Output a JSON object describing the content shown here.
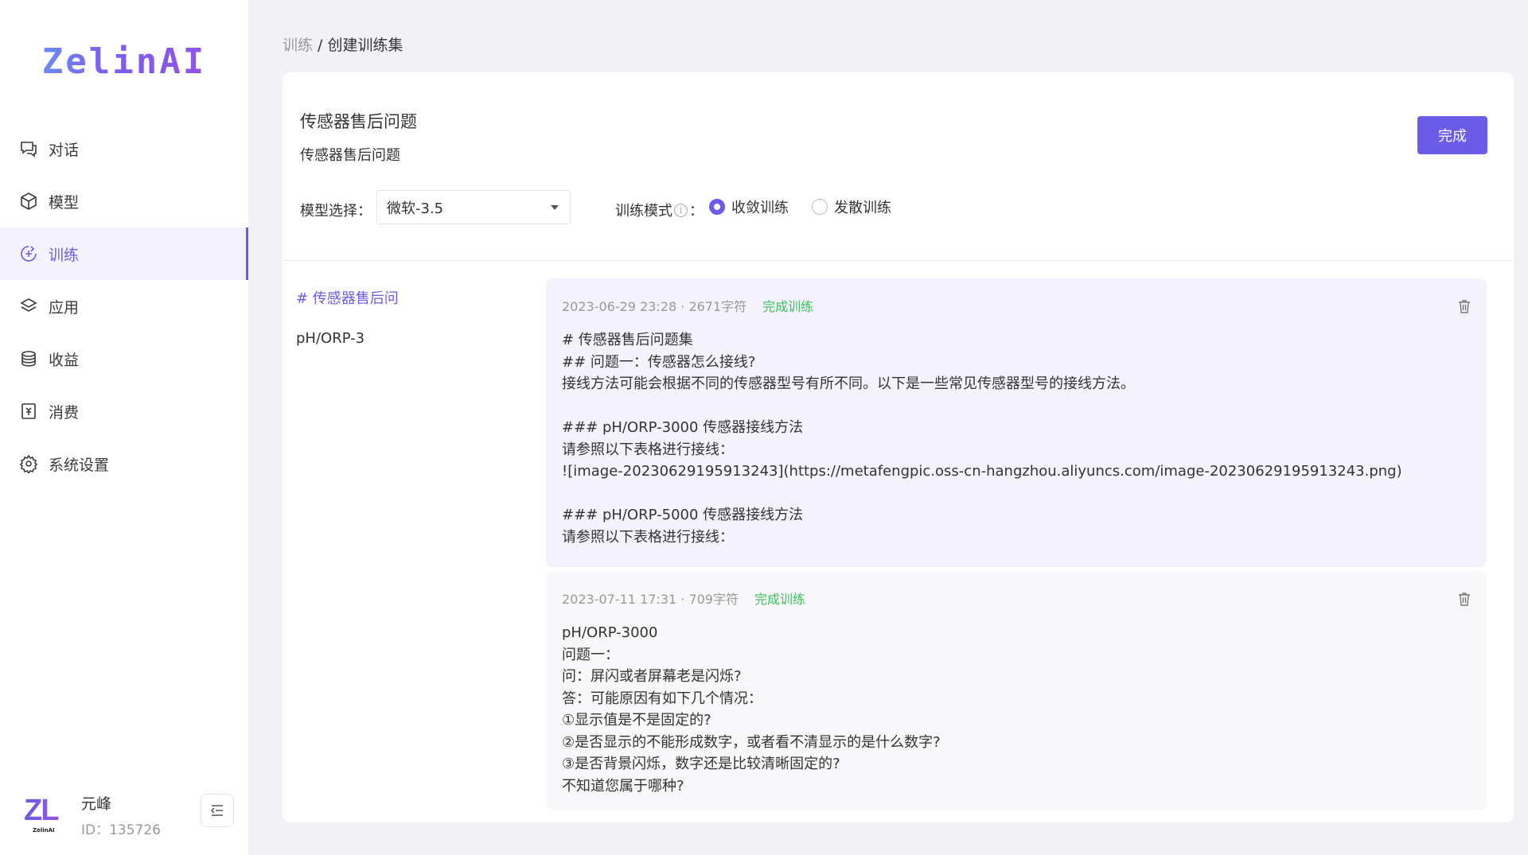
{
  "app": {
    "logo": "ZelinAI"
  },
  "sidebar": {
    "items": [
      {
        "label": "对话",
        "icon": "chat-icon"
      },
      {
        "label": "模型",
        "icon": "cube-icon"
      },
      {
        "label": "训练",
        "icon": "training-icon",
        "active": true
      },
      {
        "label": "应用",
        "icon": "layers-icon"
      },
      {
        "label": "收益",
        "icon": "coins-icon"
      },
      {
        "label": "消费",
        "icon": "receipt-icon"
      },
      {
        "label": "系统设置",
        "icon": "gear-icon"
      }
    ]
  },
  "user": {
    "avatar_text": "ZL",
    "avatar_small": "ZelinAI",
    "name": "元峰",
    "id": "ID：135726"
  },
  "breadcrumb": {
    "parent": "训练",
    "separator": " / ",
    "current": "创建训练集"
  },
  "training_set": {
    "title": "传感器售后问题",
    "description": "传感器售后问题",
    "done_label": "完成",
    "model_label": "模型选择：",
    "model_value": "微软-3.5",
    "mode_label": "训练模式",
    "mode_colon": "：",
    "modes": [
      {
        "label": "收敛训练",
        "selected": true
      },
      {
        "label": "发散训练",
        "selected": false
      }
    ]
  },
  "files": [
    {
      "label": "# 传感器售后问",
      "active": true
    },
    {
      "label": "pH/ORP-3",
      "active": false
    }
  ],
  "chunks": [
    {
      "meta": "2023-06-29 23:28 · 2671字符",
      "status": "完成训练",
      "content": "# 传感器售后问题集\n## 问题一：传感器怎么接线?\n接线方法可能会根据不同的传感器型号有所不同。以下是一些常见传感器型号的接线方法。\n\n### pH/ORP-3000 传感器接线方法\n请参照以下表格进行接线：\n![image-20230629195913243](https://metafengpic.oss-cn-hangzhou.aliyuncs.com/image-20230629195913243.png)\n\n### pH/ORP-5000 传感器接线方法\n请参照以下表格进行接线："
    },
    {
      "meta": "2023-07-11 17:31 · 709字符",
      "status": "完成训练",
      "content": "pH/ORP-3000\n问题一：\n问：屏闪或者屏幕老是闪烁?\n答：可能原因有如下几个情况：\n①显示值是不是固定的?\n②是否显示的不能形成数字，或者看不清显示的是什么数字?\n③是否背景闪烁，数字还是比较清晰固定的?\n不知道您属于哪种?"
    }
  ],
  "colors": {
    "accent": "#6a5be8",
    "success": "#3dbf5e",
    "muted": "#999999"
  }
}
